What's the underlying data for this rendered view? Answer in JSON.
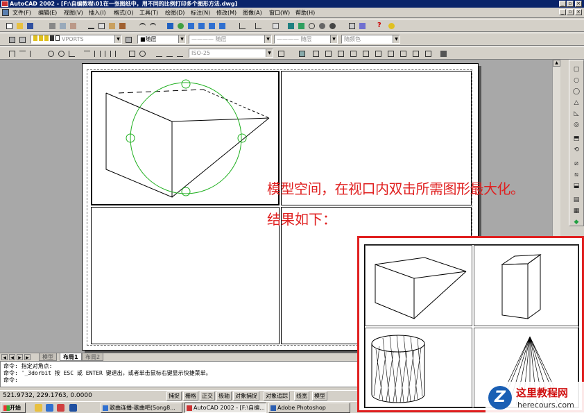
{
  "window": {
    "title": "AutoCAD 2002 - [F:\\自编教程\\01在一张图纸中，用不同的比例打印多个图形方法.dwg]",
    "controls": [
      "_",
      "▫",
      "×"
    ]
  },
  "menu": {
    "items": [
      "文件(F)",
      "编辑(E)",
      "视图(V)",
      "插入(I)",
      "格式(O)",
      "工具(T)",
      "绘图(D)",
      "标注(N)",
      "修改(M)",
      "图像(A)",
      "窗口(W)",
      "帮助(H)"
    ]
  },
  "toolbar2": {
    "layer_combo": "VPORTS",
    "color_combo": "■随层",
    "linetype_combo": "———— 随层",
    "lineweight_combo": "———— 随层",
    "plotstyle_combo": "随颜色"
  },
  "toolbar3": {
    "dimstyle_combo": "ISO-25"
  },
  "tabs": {
    "model": "模型",
    "layout1": "布局1",
    "layout2": "布局2"
  },
  "command": {
    "line1": "命令: 指定对角点:",
    "line2": "命令: '_3dorbit 按 ESC 或 ENTER 键退出，或者单击鼠标右键显示快捷菜单。",
    "line3": "命令:"
  },
  "status": {
    "coords": "521.9732, 229.1763, 0.0000",
    "toggles": [
      "捕捉",
      "栅格",
      "正交",
      "极轴",
      "对象捕捉",
      "对象追踪",
      "线宽",
      "模型"
    ]
  },
  "taskbar": {
    "start": "开始",
    "tasks": [
      "歌曲连播-歌曲吧(Song8...",
      "AutoCAD 2002 - [F:\\自编...",
      "Adobe Photoshop"
    ]
  },
  "annotation": {
    "line1": "模型空间，在视口内双击所需图形最大化。",
    "line2": "结果如下："
  },
  "watermark": {
    "logo_letter": "Z",
    "text": "这里教程网",
    "url": "herecours.com"
  },
  "colors": {
    "title_bar": "#0a246a",
    "annotation_red": "#e02020",
    "orbit_green": "#20b020"
  }
}
